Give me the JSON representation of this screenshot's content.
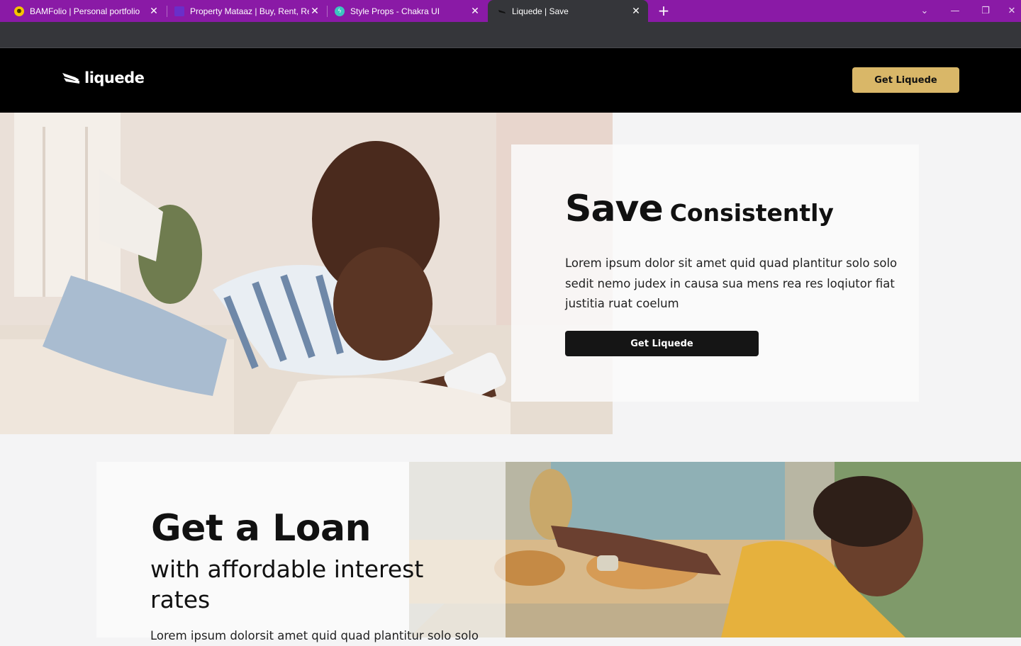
{
  "browser": {
    "tabs": [
      {
        "title": "BAMFolio | Personal portfolio",
        "favicon": "bamfolio-favicon-icon"
      },
      {
        "title": "Property Mataaz | Buy, Rent, Reli",
        "favicon": "mataaz-favicon-icon"
      },
      {
        "title": "Style Props - Chakra UI",
        "favicon": "chakra-favicon-icon"
      },
      {
        "title": "Liquede | Save",
        "favicon": "liquede-favicon-icon"
      }
    ],
    "close_glyph": "✕",
    "new_tab_glyph": "+",
    "controls": {
      "dropdown": "⌄",
      "minimize": "—",
      "restore": "❐",
      "close": "✕"
    },
    "colors": {
      "tabbar": "#8a1aa6",
      "active_tab": "#35363a"
    }
  },
  "header": {
    "logo_text": "liquede",
    "cta_label": "Get Liquede",
    "colors": {
      "background": "#000000",
      "cta": "#d9b768"
    }
  },
  "hero": {
    "title_big": "Save",
    "title_small": "Consistently",
    "body": "Lorem ipsum dolor sit amet quid quad plantitur solo solo sedit nemo judex in causa sua mens rea res loqiutor fiat justitia ruat coelum",
    "cta_label": "Get Liquede",
    "image": "woman-on-sofa-with-phone-photo"
  },
  "loan": {
    "title": "Get a Loan",
    "subtitle": "with affordable interest rates",
    "body": "Lorem ipsum dolorsit amet quid quad plantitur solo solo",
    "image": "woman-in-bakery-photo"
  }
}
